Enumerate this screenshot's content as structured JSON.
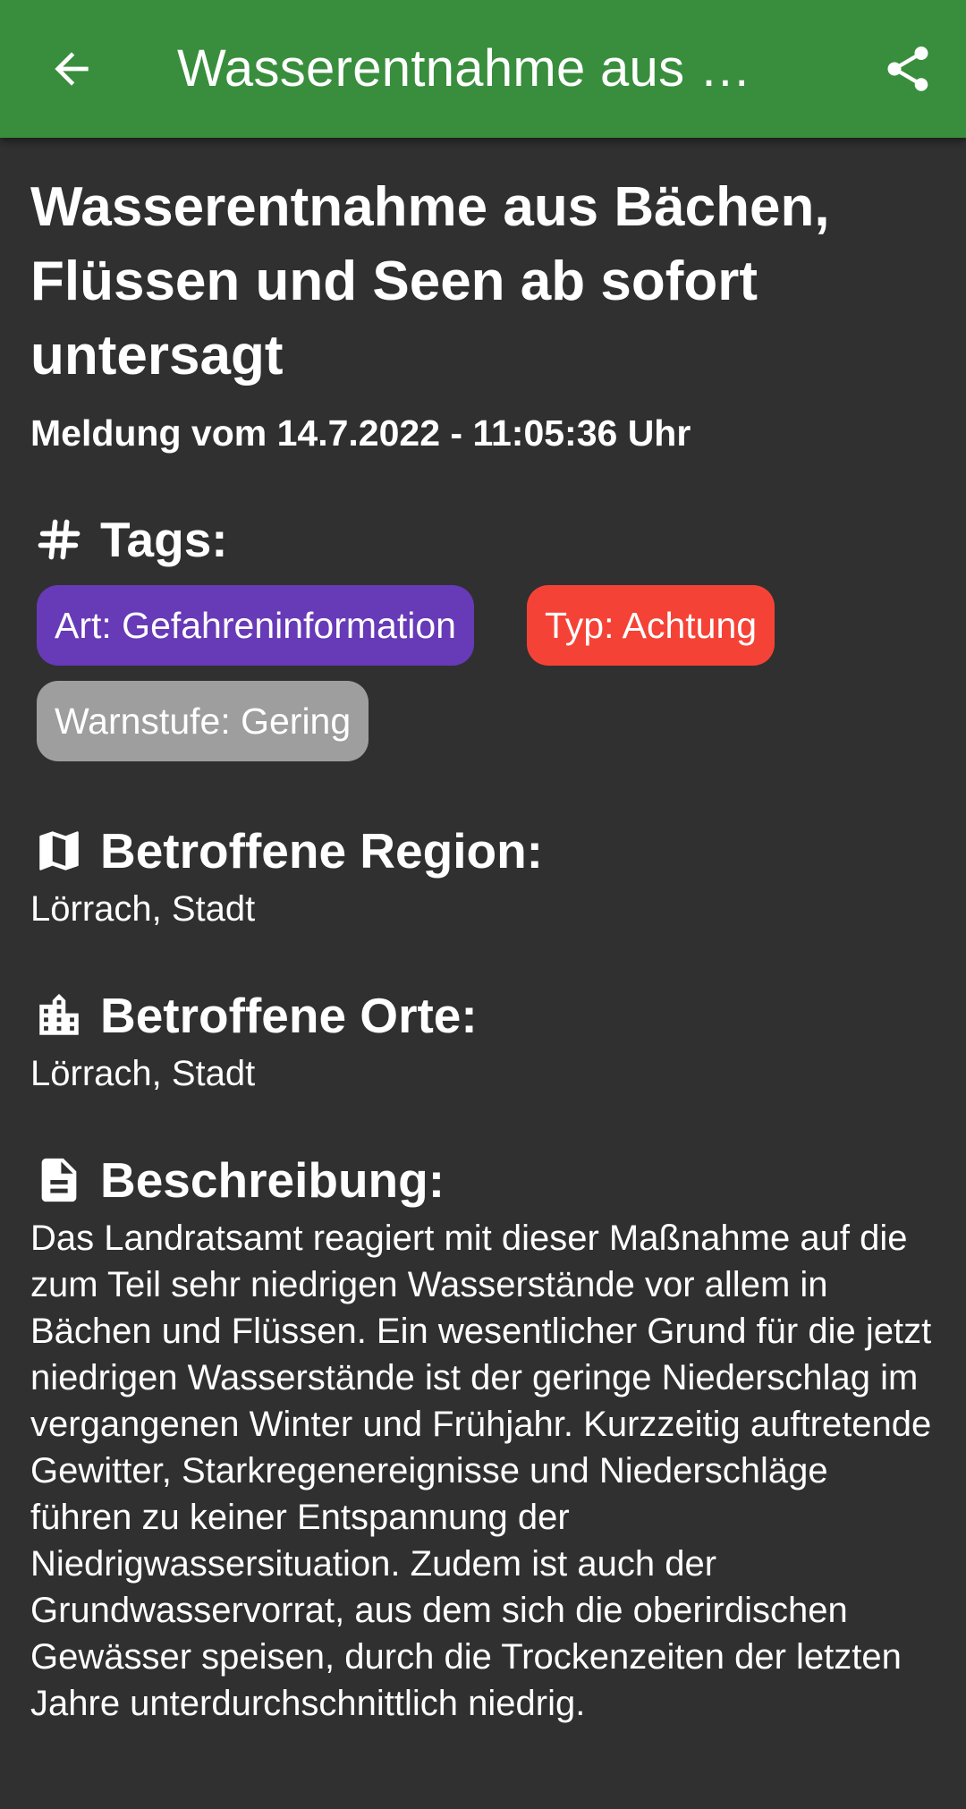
{
  "appbar": {
    "title": "Wasserentnahme aus Bächen, Flüssen und Seen ab sofort untersagt",
    "back_icon": "arrow-left-icon",
    "share_icon": "share-icon",
    "background_color": "#388e3c"
  },
  "article": {
    "headline": "Wasserentnahme aus Bächen, Flüssen und Seen ab sofort untersagt",
    "subtitle": "Meldung vom 14.7.2022 - 11:05:36 Uhr"
  },
  "tags_section": {
    "icon": "hashtag-icon",
    "label": "Tags:",
    "chips": [
      {
        "label": "Art: Gefahreninformation",
        "color": "#673ab7"
      },
      {
        "label": "Typ: Achtung",
        "color": "#f44336"
      },
      {
        "label": "Warnstufe: Gering",
        "color": "#9e9e9e"
      }
    ]
  },
  "region_section": {
    "icon": "map-icon",
    "label": "Betroffene Region:",
    "text": "Lörrach, Stadt"
  },
  "places_section": {
    "icon": "city-icon",
    "label": "Betroffene Orte:",
    "text": "Lörrach, Stadt"
  },
  "description_section": {
    "icon": "document-icon",
    "label": "Beschreibung:",
    "text": "Das Landratsamt reagiert mit dieser Maßnahme auf die zum Teil sehr niedrigen Wasserstände vor allem in Bächen und Flüssen. Ein wesentlicher Grund für die jetzt niedrigen Wasserstände ist der geringe Niederschlag im vergangenen Winter und Frühjahr. Kurzzeitig auftretende Gewitter, Starkregenereignisse und Niederschläge führen zu keiner Entspannung der Niedrigwassersituation. Zudem ist auch der Grundwasservorrat, aus dem sich die oberirdischen Gewässer speisen, durch die Trockenzeiten der letzten Jahre unterdurchschnittlich niedrig."
  }
}
